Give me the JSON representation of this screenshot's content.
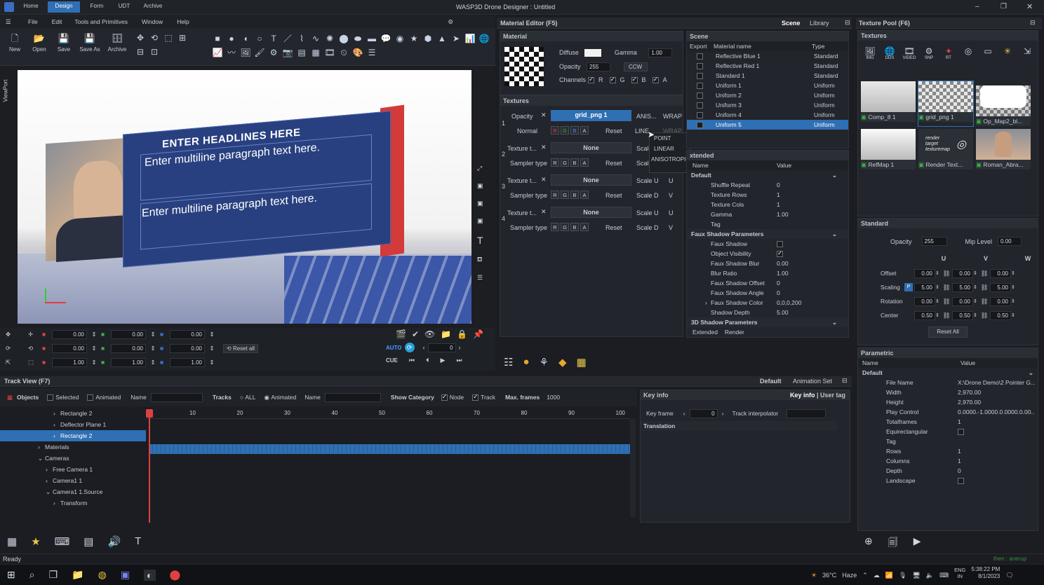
{
  "titlebar": {
    "tabs": [
      "Home",
      "Design",
      "Form",
      "UDT",
      "Archive"
    ],
    "active_tab": 1,
    "title": "WASP3D Drone Designer : Untitled",
    "minimize": "–",
    "maximize": "❐",
    "close": "✕"
  },
  "menu": {
    "items": [
      "File",
      "Edit",
      "Tools and Primitives",
      "Window",
      "Help"
    ]
  },
  "toolbar": {
    "buttons": [
      "New",
      "Open",
      "Save",
      "Save As",
      "Archive"
    ]
  },
  "viewport": {
    "side_label": "ViewPort",
    "headline": "ENTER HEADLINES HERE",
    "para1": "Enter multiline paragraph text here.",
    "para2": "Enter multiline paragraph text here."
  },
  "transform": {
    "rows": [
      [
        "0.00",
        "0.00",
        "0.00"
      ],
      [
        "0.00",
        "0.00",
        "0.00"
      ],
      [
        "1.00",
        "1.00",
        "1.00"
      ]
    ],
    "reset_all": "Reset all",
    "auto": "AUTO",
    "frame": "0",
    "cue": "CUE"
  },
  "material_editor": {
    "title": "Material Editor (F5)",
    "scene_tab": "Scene",
    "library_tab": "Library",
    "material_hdr": "Material",
    "diffuse": "Diffuse",
    "gamma_label": "Gamma",
    "gamma": "1.00",
    "opacity_label": "Opacity",
    "opacity": "255",
    "ccw": "CCW",
    "channels": "Channels",
    "ch": [
      "R",
      "G",
      "B",
      "A"
    ],
    "textures_hdr": "Textures",
    "tex1_opacity": "Opacity",
    "tex1_name": "grid_png 1",
    "aniso": "ANIS...",
    "wrap": "WRAP",
    "normal": "Normal",
    "reset": "Reset",
    "linear": "LINE...",
    "wrap2": "WRAP",
    "slots": [
      {
        "n": "2",
        "label": "Texture t...",
        "name": "None",
        "scale": "Scal"
      },
      {
        "n": "3",
        "label": "Texture t...",
        "name": "None",
        "scale": "Scale U",
        "u": "U"
      },
      {
        "n": "4",
        "label": "Texture t...",
        "name": "None",
        "scale": "Scale U",
        "u": "U"
      }
    ],
    "sampler": "Sampler type",
    "scale_d": "Scale D",
    "v": "V",
    "scale_v": "Scal",
    "dropdown": [
      "POINT",
      "LINEAR",
      "ANISOTROPIC"
    ]
  },
  "scene": {
    "hdr": "Scene",
    "cols": [
      "Export",
      "Material name",
      "Type"
    ],
    "rows": [
      [
        "Reflective Blue 1",
        "Standard"
      ],
      [
        "Reflective Red 1",
        "Standard"
      ],
      [
        "Standard 1",
        "Standard"
      ],
      [
        "Uniform 1",
        "Uniform"
      ],
      [
        "Uniform 2",
        "Uniform"
      ],
      [
        "Uniform 3",
        "Uniform"
      ],
      [
        "Uniform 4",
        "Uniform"
      ],
      [
        "Uniform 5",
        "Uniform"
      ]
    ],
    "selected": 7
  },
  "extended": {
    "hdr": "xtended",
    "cols": [
      "Name",
      "Value"
    ],
    "default": "Default",
    "props": [
      [
        "Shuffle Repeat",
        "0"
      ],
      [
        "Texture Rows",
        "1"
      ],
      [
        "Texture Cols",
        "1"
      ],
      [
        "Gamma",
        "1.00"
      ],
      [
        "Tag",
        ""
      ]
    ],
    "faux_hdr": "Faux Shadow Parameters",
    "faux": [
      [
        "Faux Shadow",
        ""
      ],
      [
        "Object Visibility",
        ""
      ],
      [
        "Faux Shadow Blur",
        "0.00"
      ],
      [
        "Blur Ratio",
        "1.00"
      ],
      [
        "Faux Shadow Offset",
        "0"
      ],
      [
        "Faux Shadow Angle",
        "0"
      ],
      [
        "Faux Shadow Color",
        "0,0,0,200"
      ],
      [
        "Shadow Depth",
        "5.00"
      ]
    ],
    "shadow3d": "3D Shadow Parameters",
    "tabs": [
      "Extended",
      "Render"
    ]
  },
  "texture_pool": {
    "title": "Texture Pool (F6)",
    "textures_hdr": "Textures",
    "top_icons": [
      "IMG",
      "DDS",
      "VIDEO",
      "SNP",
      "RT"
    ],
    "items": [
      "Comp_8 1",
      "grid_png 1",
      "Op_Map2_bl...",
      "RefMap 1",
      "Render Text...",
      "Roman_Abra..."
    ],
    "render_target": "render target texturemap"
  },
  "standard": {
    "hdr": "Standard",
    "opacity_label": "Opacity",
    "opacity": "255",
    "mip_label": "Mip Level",
    "mip": "0.00",
    "cols": [
      "U",
      "V",
      "W"
    ],
    "rows": [
      [
        "Offset",
        "0.00",
        "0.00",
        "0.00"
      ],
      [
        "Scaling",
        "5.00",
        "5.00",
        "5.00"
      ],
      [
        "Rotation",
        "0.00",
        "0.00",
        "0.00"
      ],
      [
        "Center",
        "0.50",
        "0.50",
        "0.50"
      ]
    ],
    "p": "P",
    "reset_all": "Reset All"
  },
  "parametric": {
    "hdr": "Parametric",
    "cols": [
      "Name",
      "Value"
    ],
    "default": "Default",
    "props": [
      [
        "File Name",
        "X:\\Drone Demo\\2 Pointer G..."
      ],
      [
        "Width",
        "2,970.00"
      ],
      [
        "Height",
        "2,970.00"
      ],
      [
        "Play Control",
        "0.0000.-1.0000.0.0000.0.00..."
      ],
      [
        "Totalframes",
        "1"
      ],
      [
        "Equirectangular",
        ""
      ],
      [
        "Tag",
        ""
      ],
      [
        "Rows",
        "1"
      ],
      [
        "Columns",
        "1"
      ],
      [
        "Depth",
        "0"
      ],
      [
        "Landscape",
        ""
      ]
    ]
  },
  "track_view": {
    "title": "Track View (F7)",
    "default": "Default",
    "anim_set": "Animation Set",
    "objects": "Objects",
    "selected": "Selected",
    "animated": "Animated",
    "name": "Name",
    "tracks": "Tracks",
    "all": "ALL",
    "animated2": "Animated",
    "name2": "Name",
    "show_cat": "Show Category",
    "node": "Node",
    "track": "Track",
    "max_frames_label": "Max. frames",
    "max_frames": "1000",
    "ruler": [
      "10",
      "20",
      "30",
      "40",
      "50",
      "60",
      "70",
      "80",
      "90",
      "100"
    ],
    "tree": [
      {
        "t": "Rectangle 2",
        "lvl": 2,
        "exp": "›"
      },
      {
        "t": "Deflector Plane 1",
        "lvl": 2,
        "exp": "›"
      },
      {
        "t": "Rectangle 2",
        "lvl": 2,
        "exp": "›",
        "sel": true
      },
      {
        "t": "Materials",
        "lvl": 0,
        "exp": "›"
      },
      {
        "t": "Cameras",
        "lvl": 0,
        "exp": "⌄"
      },
      {
        "t": "Free Camera 1",
        "lvl": 1,
        "exp": "›"
      },
      {
        "t": "Camera1 1",
        "lvl": 1,
        "exp": "›"
      },
      {
        "t": "Camera1 1.Source",
        "lvl": 1,
        "exp": "⌄"
      },
      {
        "t": "Transform",
        "lvl": 2,
        "exp": "›"
      }
    ]
  },
  "key_info": {
    "hdr": "Key info",
    "tab1": "Key info",
    "tab2": "User tag",
    "key_frame": "Key frame",
    "kf_value": "0",
    "interp": "Track interpolator",
    "translation": "Translation"
  },
  "status": {
    "text": "Ready",
    "right": "then : anerup"
  },
  "taskbar": {
    "temp": "36°C",
    "weather": "Haze",
    "lang1": "ENG",
    "lang2": "IN",
    "time": "5:38:22 PM",
    "date": "8/1/2023"
  },
  "colors": {
    "accent": "#2f6fb3",
    "playhead": "#e04040"
  }
}
